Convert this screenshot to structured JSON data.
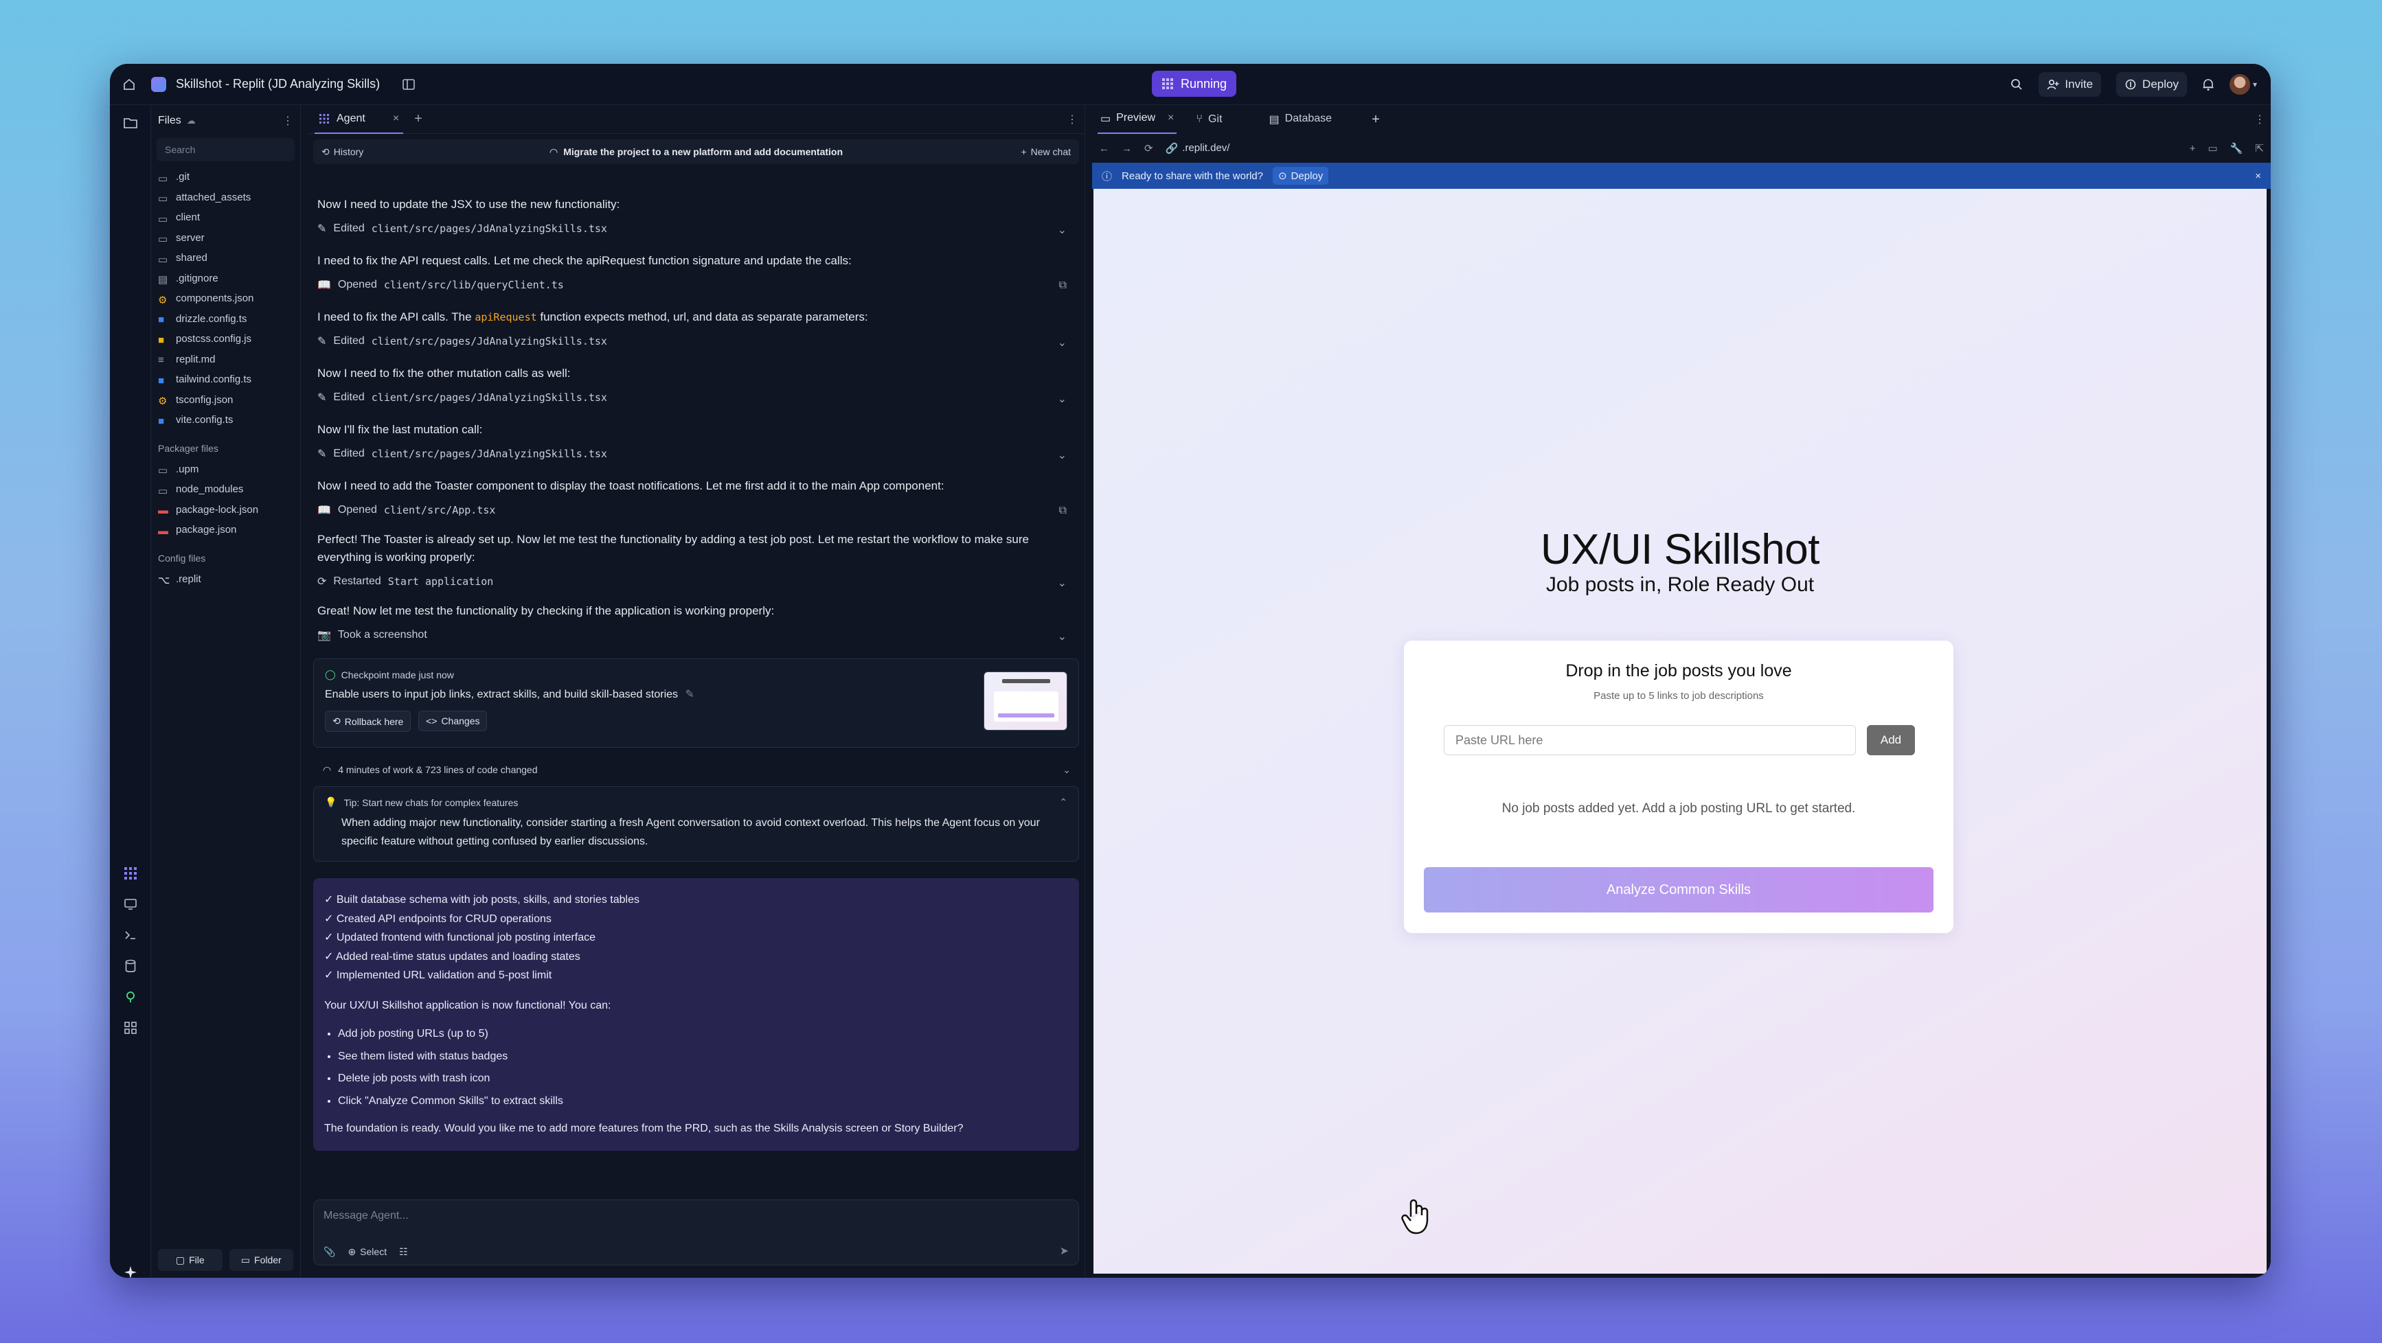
{
  "topbar": {
    "project_title": "Skillshot - Replit (JD Analyzing Skills)",
    "status": "Running",
    "invite": "Invite",
    "deploy": "Deploy"
  },
  "files": {
    "title": "Files",
    "search_placeholder": "Search",
    "items": [
      ".git",
      "attached_assets",
      "client",
      "server",
      "shared",
      ".gitignore",
      "components.json",
      "drizzle.config.ts",
      "postcss.config.js",
      "replit.md",
      "tailwind.config.ts",
      "tsconfig.json",
      "vite.config.ts"
    ],
    "packager_title": "Packager files",
    "packager_items": [
      ".upm",
      "node_modules",
      "package-lock.json",
      "package.json"
    ],
    "config_title": "Config files",
    "config_items": [
      ".replit"
    ],
    "file_btn": "File",
    "folder_btn": "Folder"
  },
  "agent": {
    "tab": "Agent",
    "history": "History",
    "thread_title": "Migrate the project to a new platform and add documentation",
    "new_chat": "New chat",
    "messages": [
      {
        "text": "Now I need to update the JSX to use the new functionality:",
        "verb": "Edited",
        "file": "client/src/pages/JdAnalyzingSkills.tsx"
      },
      {
        "text": "I need to fix the API request calls. Let me check the apiRequest function signature and update the calls:",
        "verb": "Opened",
        "file": "client/src/lib/queryClient.ts"
      },
      {
        "text_pre": "I need to fix the API calls. The ",
        "code": "apiRequest",
        "text_post": " function expects method, url, and data as separate parameters:",
        "verb": "Edited",
        "file": "client/src/pages/JdAnalyzingSkills.tsx"
      },
      {
        "text": "Now I need to fix the other mutation calls as well:",
        "verb": "Edited",
        "file": "client/src/pages/JdAnalyzingSkills.tsx"
      },
      {
        "text": "Now I'll fix the last mutation call:",
        "verb": "Edited",
        "file": "client/src/pages/JdAnalyzingSkills.tsx"
      },
      {
        "text": "Now I need to add the Toaster component to display the toast notifications. Let me first add it to the main App component:",
        "verb": "Opened",
        "file": "client/src/App.tsx"
      },
      {
        "text": "Perfect! The Toaster is already set up. Now let me test the functionality by adding a test job post. Let me restart the workflow to make sure everything is working properly:",
        "verb": "Restarted",
        "file": "Start application"
      },
      {
        "text": "Great! Now let me test the functionality by checking if the application is working properly:",
        "verb": "Took a screenshot",
        "file": ""
      }
    ],
    "checkpoint": {
      "label": "Checkpoint made just now",
      "text": "Enable users to input job links, extract skills, and build skill-based stories",
      "rollback": "Rollback here",
      "changes": "Changes"
    },
    "work_summary": "4 minutes of work & 723 lines of code changed",
    "tip": {
      "title": "Tip: Start new chats for complex features",
      "text": "When adding major new functionality, consider starting a fresh Agent conversation to avoid context overload. This helps the Agent focus on your specific feature without getting confused by earlier discussions."
    },
    "summary": {
      "checks": [
        "✓ Built database schema with job posts, skills, and stories tables",
        "✓ Created API endpoints for CRUD operations",
        "✓ Updated frontend with functional job posting interface",
        "✓ Added real-time status updates and loading states",
        "✓ Implemented URL validation and 5-post limit"
      ],
      "intro": "Your UX/UI Skillshot application is now functional! You can:",
      "bullets": [
        "Add job posting URLs (up to 5)",
        "See them listed with status badges",
        "Delete job posts with trash icon",
        "Click \"Analyze Common Skills\" to extract skills"
      ],
      "closing": "The foundation is ready. Would you like me to add more features from the PRD, such as the Skills Analysis screen or Story Builder?"
    },
    "composer_placeholder": "Message Agent...",
    "select": "Select"
  },
  "preview": {
    "tabs": [
      "Preview",
      "Git",
      "Database"
    ],
    "url": ".replit.dev/",
    "banner_text": "Ready to share with the world?",
    "banner_deploy": "Deploy",
    "app": {
      "title": "UX/UI Skillshot",
      "subtitle": "Job posts in, Role Ready Out",
      "card_title": "Drop in the job posts you love",
      "card_hint": "Paste up to 5 links to job descriptions",
      "input_placeholder": "Paste URL here",
      "add": "Add",
      "empty": "No job posts added yet. Add a job posting URL to get started.",
      "analyze": "Analyze Common Skills"
    }
  }
}
